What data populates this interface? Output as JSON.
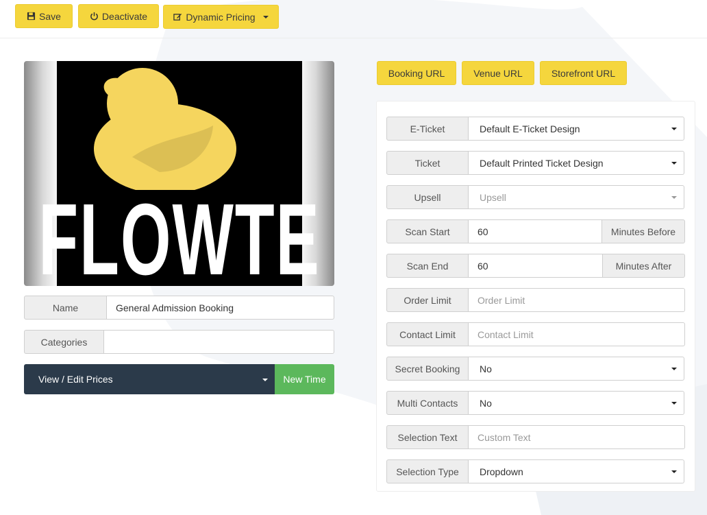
{
  "toolbar": {
    "save_label": "Save",
    "deactivate_label": "Deactivate",
    "dynamic_pricing_label": "Dynamic Pricing"
  },
  "url_buttons": {
    "booking_url": "Booking URL",
    "venue_url": "Venue URL",
    "storefront_url": "Storefront URL"
  },
  "product": {
    "logo_text": "FLOWTE",
    "name_label": "Name",
    "name_value": "General Admission Booking",
    "categories_label": "Categories",
    "categories_value": "",
    "prices_label": "View / Edit Prices",
    "new_time_label": "New Time"
  },
  "settings": {
    "eticket": {
      "label": "E-Ticket",
      "value": "Default E-Ticket Design"
    },
    "ticket": {
      "label": "Ticket",
      "value": "Default Printed Ticket Design"
    },
    "upsell": {
      "label": "Upsell",
      "placeholder": "Upsell"
    },
    "scan_start": {
      "label": "Scan Start",
      "value": "60",
      "suffix": "Minutes Before"
    },
    "scan_end": {
      "label": "Scan End",
      "value": "60",
      "suffix": "Minutes After"
    },
    "order_limit": {
      "label": "Order Limit",
      "placeholder": "Order Limit"
    },
    "contact_limit": {
      "label": "Contact Limit",
      "placeholder": "Contact Limit"
    },
    "secret_booking": {
      "label": "Secret Booking",
      "value": "No"
    },
    "multi_contacts": {
      "label": "Multi Contacts",
      "value": "No"
    },
    "selection_text": {
      "label": "Selection Text",
      "placeholder": "Custom Text"
    },
    "selection_type": {
      "label": "Selection Type",
      "value": "Dropdown"
    }
  },
  "colors": {
    "accent_yellow": "#f5d63d",
    "dark_navy": "#2b3a4a",
    "success_green": "#5cb85c",
    "duck_yellow": "#f5d55e"
  }
}
